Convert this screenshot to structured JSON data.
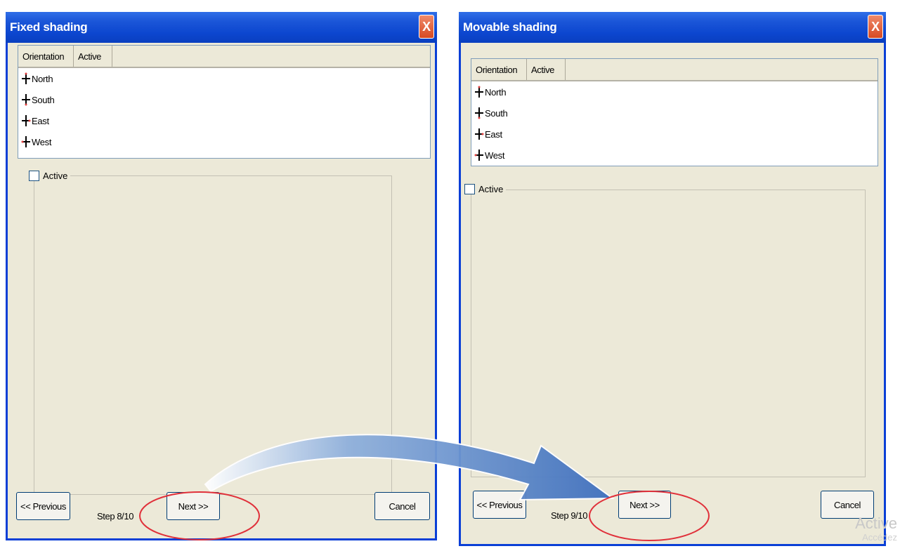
{
  "left_dialog": {
    "title": "Fixed shading",
    "close_label": "X",
    "columns": [
      "Orientation",
      "Active"
    ],
    "rows": [
      "North",
      "South",
      "East",
      "West"
    ],
    "checkbox_label": "Active",
    "prev_label": "<< Previous",
    "step_label": "Step 8/10",
    "next_label": "Next >>",
    "cancel_label": "Cancel"
  },
  "right_dialog": {
    "title": "Movable shading",
    "close_label": "X",
    "columns": [
      "Orientation",
      "Active"
    ],
    "rows": [
      "North",
      "South",
      "East",
      "West"
    ],
    "checkbox_label": "Active",
    "prev_label": "<< Previous",
    "step_label": "Step 9/10",
    "next_label": "Next >>",
    "cancel_label": "Cancel"
  },
  "watermark": {
    "line1": "Active",
    "line2": "Accédez"
  },
  "colors": {
    "titlebar": "#0c46cf",
    "dialog_bg": "#ece9d8",
    "highlight_ellipse": "#e0303a",
    "arrow": "#4a78c0"
  }
}
